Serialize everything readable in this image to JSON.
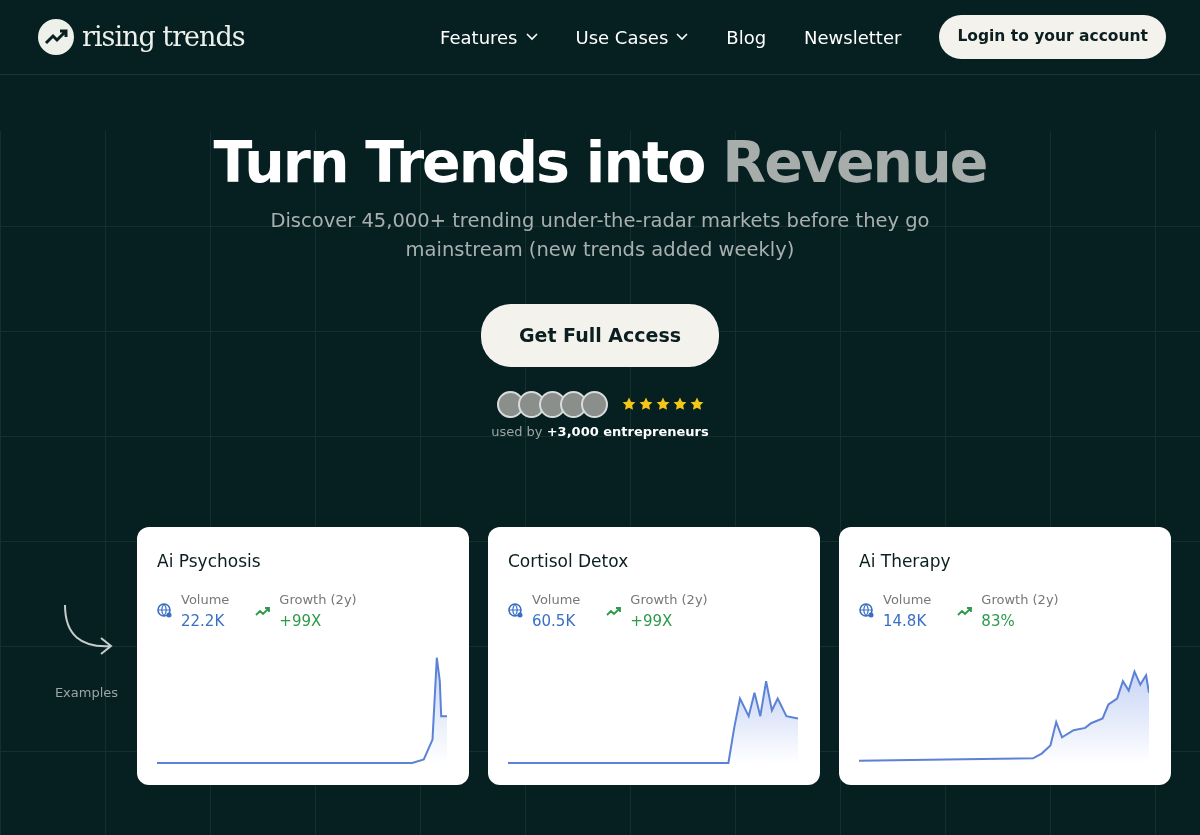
{
  "brand": {
    "name": "rising trends"
  },
  "nav": [
    {
      "label": "Features",
      "dropdown": true
    },
    {
      "label": "Use Cases",
      "dropdown": true
    },
    {
      "label": "Blog",
      "dropdown": false
    },
    {
      "label": "Newsletter",
      "dropdown": false
    }
  ],
  "login_button": "Login to your account",
  "hero": {
    "title": "Turn Trends into",
    "title_highlight": "Revenue",
    "subtitle": "Discover 45,000+ trending under-the-radar markets before they go mainstream (new trends added weekly)",
    "cta": "Get Full Access"
  },
  "social_proof": {
    "stars": 5,
    "text": "used by **+3,000 entrepreneurs**"
  },
  "examples_label": "Examples",
  "cards": [
    {
      "title": "Ai Psychosis",
      "volume_label": "Volume",
      "volume": "22.2K",
      "growth_label": "Growth (2y)",
      "growth": "+99X"
    },
    {
      "title": "Cortisol Detox",
      "volume_label": "Volume",
      "volume": "60.5K",
      "growth_label": "Growth (2y)",
      "growth": "+99X"
    },
    {
      "title": "Ai Therapy",
      "volume_label": "Volume",
      "volume": "14.8K",
      "growth_label": "Growth (2y)",
      "growth": "83%"
    }
  ]
}
